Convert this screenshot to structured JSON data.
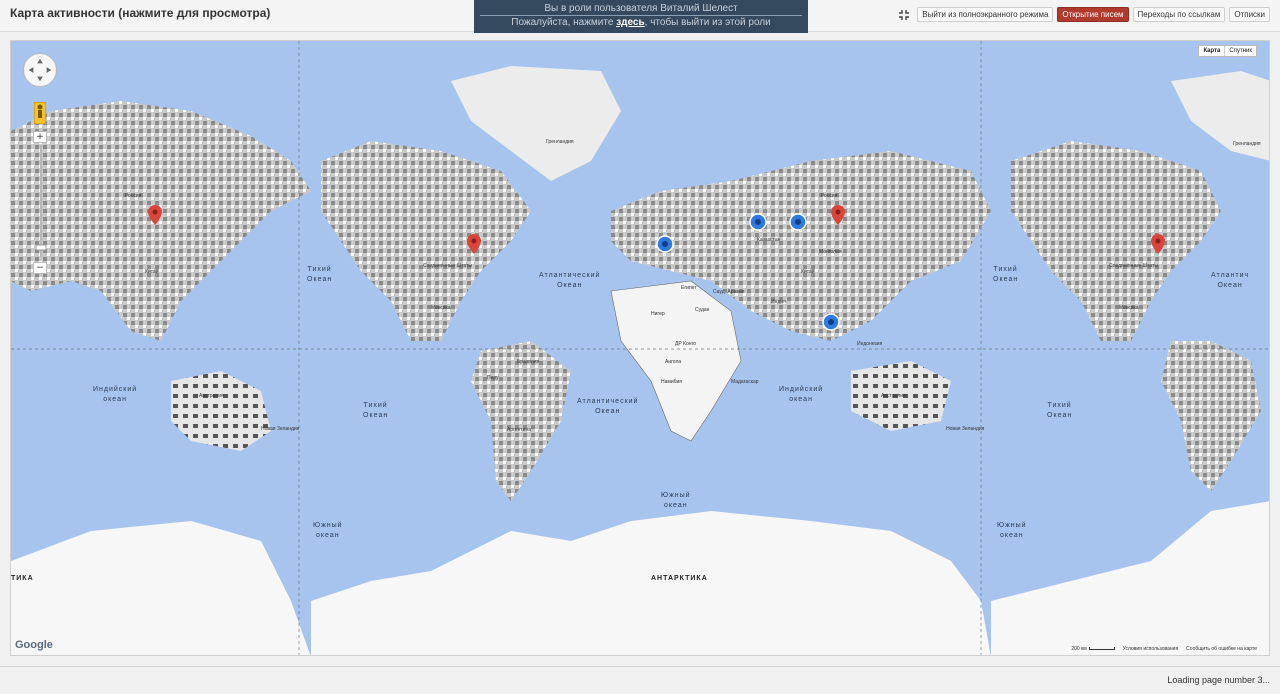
{
  "page": {
    "title": "Карта активности (нажмите для просмотра)"
  },
  "role_banner": {
    "line1": "Вы в роли пользователя Виталий Шелест",
    "line2_prefix": "Пожалуйста, нажмите ",
    "link_text": "здесь",
    "line2_suffix": ", чтобы выйти из этой роли"
  },
  "toolbar": {
    "exit_fullscreen_label": "Выйти из полноэкранного режима",
    "opened_letters_label": "Открытие писем",
    "link_clicks_label": "Переходы по ссылкам",
    "unsubscribe_label": "Отписки",
    "active_tab": "Открытие писем",
    "active_color": "#b03a2e"
  },
  "map": {
    "type_map": "Карта",
    "type_satellite": "Спутник",
    "zoom_in": "+",
    "zoom_out": "−",
    "google": "Google",
    "scale_label": "200 км",
    "terms": "Условия использования",
    "report": "Сообщить об ошибке на карте",
    "labels": {
      "pacific_left": "Тихий\nОкеан",
      "atlantic_north": "Атлантический\nОкеан",
      "pacific_right": "Тихий\nОкеан",
      "atlantic_north_right": "Атлантич\nОкеан",
      "indian_left": "Индийский\nокеан",
      "pacific_south_left": "Тихий\nОкеан",
      "atlantic_south": "Атлантический\nОкеан",
      "indian_center": "Индийский\nокеан",
      "pacific_south_right": "Тихий\nОкеан",
      "southern_center": "Южный\nокеан",
      "southern_left": "Южный\nокеан",
      "southern_right": "Южный\nокеан",
      "antarctica": "АНТАРКТИКА",
      "antarctica_left": "ТИКА",
      "greenland": "Гренландия",
      "greenland_right": "Гренландия",
      "australia_left": "Австралия",
      "australia_center": "Австралия",
      "argentina": "Аргентина",
      "brazil": "Бразилия",
      "nz_left": "Новая Зеландия",
      "nz_right": "Новая Зеландия",
      "usa": "Соединённые Штаты",
      "usa_right": "Соединённые Штаты",
      "china": "Китай",
      "china_left": "Китай",
      "india": "Индия",
      "russia": "Россия",
      "russia_left": "Россия",
      "mongolia": "Монголия",
      "kazakhstan": "Казахстан",
      "mexico": "Мексика",
      "mexico_right": "Мексика",
      "peru": "Перу",
      "niger": "Нигер",
      "sudan": "Судан",
      "drc": "ДР Конго",
      "angola": "Ангола",
      "namibia": "Намибия",
      "madagascar": "Мадагаскар",
      "indonesia": "Индонезия",
      "sa": "Сауд. Аравия",
      "egypt": "Египет"
    },
    "markers_red_color": "#d9453a",
    "markers_blue_color": "#2d7be0"
  },
  "status": {
    "loading": "Loading page number 3..."
  }
}
